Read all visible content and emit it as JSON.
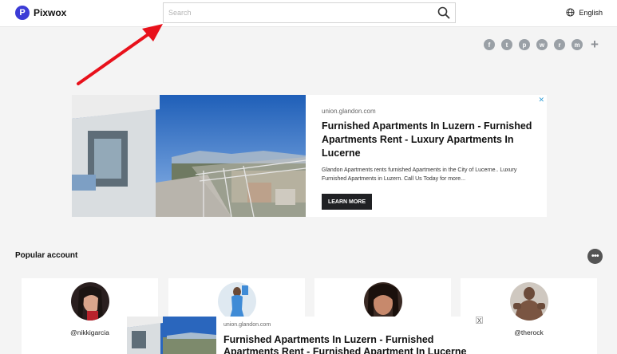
{
  "app": {
    "name": "Pixwox",
    "logo_letter": "P",
    "brand_color": "#3b3bd6"
  },
  "search": {
    "placeholder": "Search"
  },
  "language": {
    "label": "English"
  },
  "share": {
    "icons": [
      "facebook-icon",
      "twitter-icon",
      "pinterest-icon",
      "whatsapp-icon",
      "reddit-icon",
      "messenger-icon",
      "plus-icon"
    ],
    "glyphs": [
      "f",
      "t",
      "p",
      "w",
      "r",
      "m",
      "+"
    ]
  },
  "annotation": {
    "color": "#e8111b"
  },
  "ad": {
    "domain": "union.glandon.com",
    "title": "Furnished Apartments In Luzern - Furnished Apartments Rent - Luxury Apartments In Lucerne",
    "description": "Glandon Apartments rents furnished Apartments in the City of Lucerne.. Luxury Furnished Apartments in Luzern. Call Us Today for more...",
    "cta": "LEARN MORE",
    "adchoice": "✕"
  },
  "popular": {
    "title": "Popular account",
    "more": "•••",
    "accounts": [
      {
        "handle": "@nikkigarcia"
      },
      {
        "handle": ""
      },
      {
        "handle": ""
      },
      {
        "handle": "@therock"
      }
    ]
  },
  "ad2": {
    "domain": "union.glandon.com",
    "title": "Furnished Apartments In Luzern - Furnished Apartments Rent - Furnished Apartment In Lucerne",
    "close": "X"
  }
}
